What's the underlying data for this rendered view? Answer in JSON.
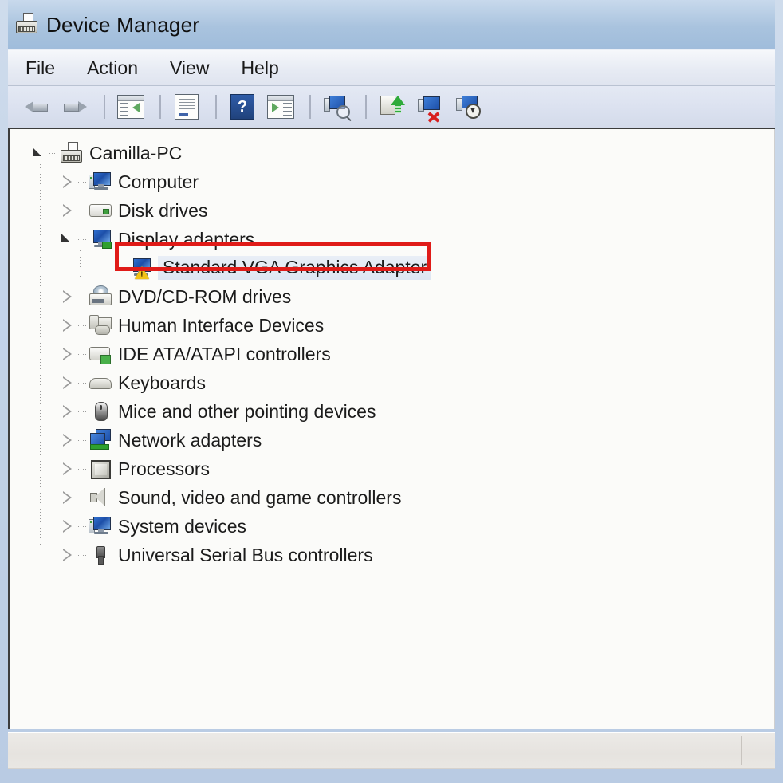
{
  "window": {
    "title": "Device Manager",
    "title_icon": "device-manager-icon"
  },
  "menu": {
    "items": [
      {
        "label": "File"
      },
      {
        "label": "Action"
      },
      {
        "label": "View"
      },
      {
        "label": "Help"
      }
    ]
  },
  "toolbar": {
    "buttons": [
      {
        "name": "back-button",
        "icon": "arrow-back-icon"
      },
      {
        "name": "forward-button",
        "icon": "arrow-forward-icon"
      },
      {
        "name": "show-hide-console-tree-button",
        "icon": "console-tree-icon"
      },
      {
        "name": "properties-button",
        "icon": "properties-document-icon"
      },
      {
        "name": "help-button",
        "icon": "help-question-icon"
      },
      {
        "name": "show-hide-action-pane-button",
        "icon": "action-pane-icon"
      },
      {
        "name": "scan-for-hardware-changes-button",
        "icon": "scan-magnifier-icon"
      },
      {
        "name": "update-driver-software-button",
        "icon": "update-driver-green-arrow-icon"
      },
      {
        "name": "uninstall-device-button",
        "icon": "uninstall-red-x-icon"
      },
      {
        "name": "disable-device-button",
        "icon": "disable-device-icon"
      }
    ]
  },
  "tree": {
    "root": {
      "label": "Camilla-PC",
      "icon": "device-manager-computer-icon",
      "state": "expanded"
    },
    "nodes": [
      {
        "label": "Computer",
        "icon": "computer-icon",
        "state": "collapsed",
        "depth": 1
      },
      {
        "label": "Disk drives",
        "icon": "disk-drive-icon",
        "state": "collapsed",
        "depth": 1
      },
      {
        "label": "Display adapters",
        "icon": "display-adapter-icon",
        "state": "expanded",
        "depth": 1
      },
      {
        "label": "Standard VGA Graphics Adapter",
        "icon": "display-adapter-warning-icon",
        "state": "leaf",
        "depth": 2,
        "selected": true,
        "annotated": true,
        "warning": true
      },
      {
        "label": "DVD/CD-ROM drives",
        "icon": "dvd-cd-rom-icon",
        "state": "collapsed",
        "depth": 1
      },
      {
        "label": "Human Interface Devices",
        "icon": "human-interface-device-icon",
        "state": "collapsed",
        "depth": 1
      },
      {
        "label": "IDE ATA/ATAPI controllers",
        "icon": "ide-controller-icon",
        "state": "collapsed",
        "depth": 1
      },
      {
        "label": "Keyboards",
        "icon": "keyboard-icon",
        "state": "collapsed",
        "depth": 1
      },
      {
        "label": "Mice and other pointing devices",
        "icon": "mouse-icon",
        "state": "collapsed",
        "depth": 1
      },
      {
        "label": "Network adapters",
        "icon": "network-adapter-icon",
        "state": "collapsed",
        "depth": 1
      },
      {
        "label": "Processors",
        "icon": "processor-icon",
        "state": "collapsed",
        "depth": 1
      },
      {
        "label": "Sound, video and game controllers",
        "icon": "sound-speaker-icon",
        "state": "collapsed",
        "depth": 1
      },
      {
        "label": "System devices",
        "icon": "system-device-icon",
        "state": "collapsed",
        "depth": 1
      },
      {
        "label": "Universal Serial Bus controllers",
        "icon": "usb-controller-icon",
        "state": "collapsed",
        "depth": 1
      }
    ]
  },
  "statusbar": {
    "text": ""
  },
  "colors": {
    "annotation_red": "#e01b18",
    "title_bar_blue": "#a9c3de",
    "frame_blue": "#bdd0e6",
    "selection_blue": "#e2e9f4",
    "warning_yellow": "#f2c318"
  }
}
